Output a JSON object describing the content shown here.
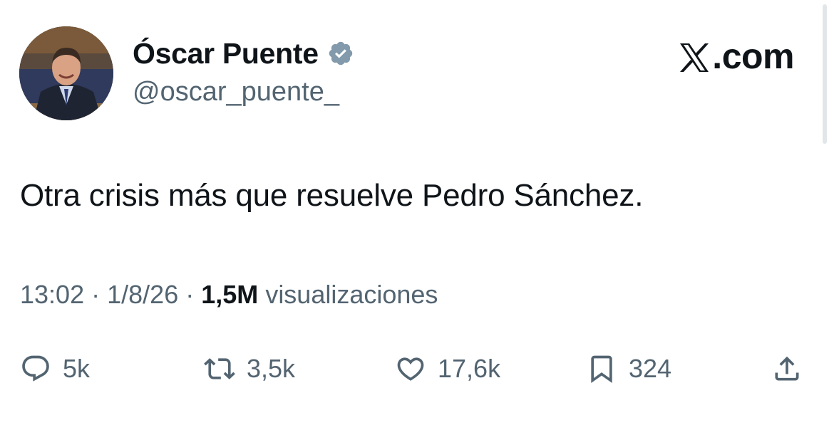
{
  "author": {
    "name": "Óscar Puente",
    "handle": "@oscar_puente_",
    "verified": true,
    "verified_color": "#829aab"
  },
  "brand": {
    "label": ".com"
  },
  "tweet": {
    "text": "Otra crisis más que resuelve Pedro Sánchez."
  },
  "meta": {
    "time": "13:02",
    "separator": "·",
    "date": "1/8/26",
    "views_count": "1,5M",
    "views_label": "visualizaciones"
  },
  "actions": {
    "replies": "5k",
    "reposts": "3,5k",
    "likes": "17,6k",
    "bookmarks": "324"
  },
  "colors": {
    "text": "#0f1419",
    "secondary": "#536471"
  }
}
